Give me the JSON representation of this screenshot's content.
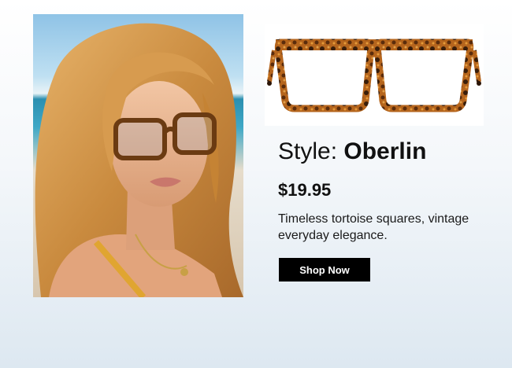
{
  "hero": {
    "image_alt": "Woman wearing tortoise square glasses on a beach"
  },
  "product": {
    "image_alt": "Tortoise square eyeglasses",
    "frame_color": "#8a4a12",
    "style_prefix": "Style: ",
    "style_name": "Oberlin",
    "price": "$19.95",
    "description": "Timeless tortoise squares, vintage everyday elegance.",
    "cta_label": "Shop Now"
  }
}
